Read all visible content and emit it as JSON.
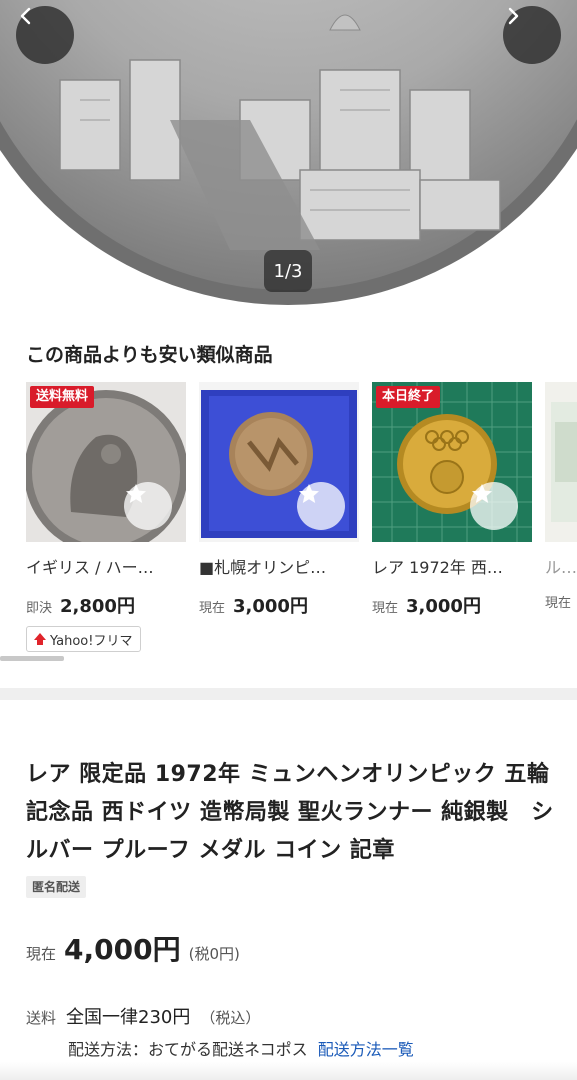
{
  "gallery": {
    "counter": "1/3",
    "prev_icon": "chevron-left-icon",
    "next_icon": "chevron-right-icon"
  },
  "similar": {
    "title": "この商品よりも安い類似商品",
    "items": [
      {
        "tag": "送料無料",
        "title": "イギリス / ハー…",
        "price_label": "即決",
        "price": "2,800円",
        "badge": "Yahoo!フリマ"
      },
      {
        "tag": "",
        "title": "■札幌オリンピ…",
        "price_label": "現在",
        "price": "3,000円"
      },
      {
        "tag": "本日終了",
        "title": "レア 1972年 西…",
        "price_label": "現在",
        "price": "3,000円"
      },
      {
        "tag": "",
        "title": "ルー…",
        "price_label": "現在",
        "price": ""
      }
    ]
  },
  "item": {
    "title": "レア 限定品 1972年 ミュンヘンオリンピック 五輪 記念品 西ドイツ 造幣局製 聖火ランナー 純銀製　シルバー プルーフ メダル コイン 記章",
    "anon_badge": "匿名配送",
    "current_label": "現在",
    "current_price": "4,000円",
    "tax_note": "(税0円)",
    "shipping_label": "送料",
    "shipping_value": "全国一律230円",
    "shipping_tax": "（税込）",
    "method_text": "配送方法：おてがる配送ネコポス",
    "method_link": "配送方法一覧"
  },
  "colors": {
    "tag_red": "#d91b2a",
    "link_blue": "#1a5ab8",
    "flea_red": "#e0242b"
  }
}
